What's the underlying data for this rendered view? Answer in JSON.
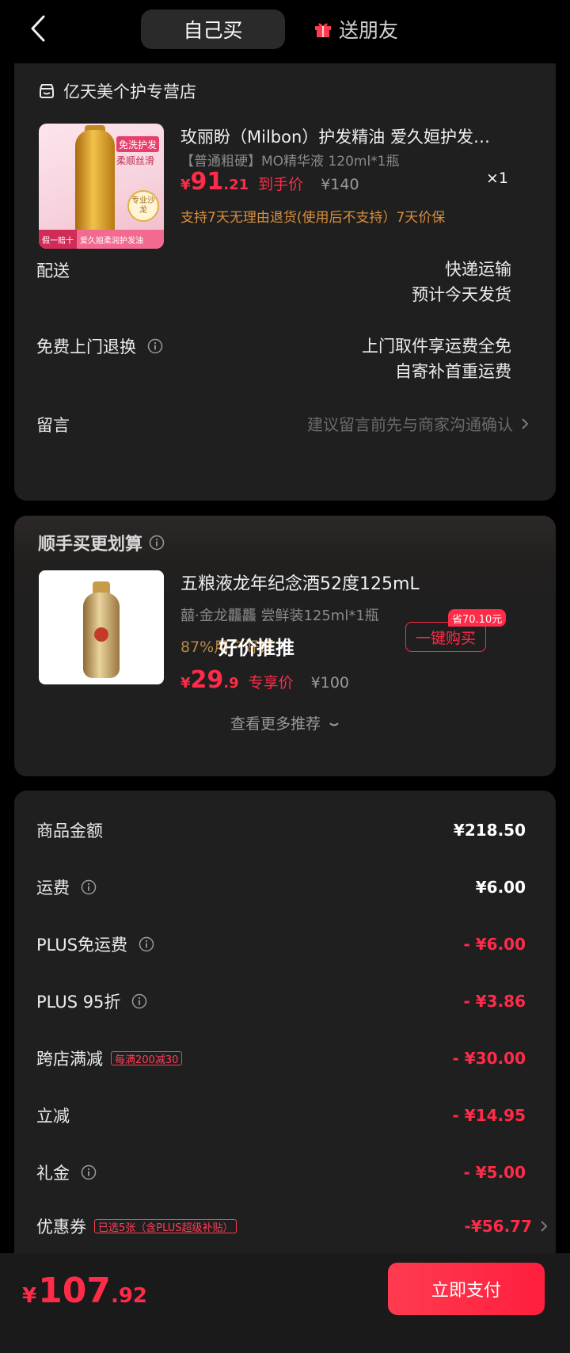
{
  "header": {
    "tab_self": "自己买",
    "tab_friend": "送朋友"
  },
  "store": {
    "name": "亿天美个护专营店",
    "product": {
      "image_texts": {
        "badge": "免洗护发",
        "headline": "柔顺丝滑",
        "seal": "专业沙龙",
        "footer_left": "假一赔十",
        "footer_right": "爱久姮柔润护发油"
      },
      "title": "玫丽盼（Milbon）护发精油 爱久姮护发精…",
      "sku": "【普通粗硬】MO精华液 120ml*1瓶",
      "price_yen": "¥",
      "price_int": "91",
      "price_dec": ".21",
      "price_label": "到手价",
      "original_price": "¥140",
      "quantity": "×1",
      "promise": "支持7天无理由退货(使用后不支持）7天价保"
    },
    "delivery": {
      "label": "配送",
      "line1": "快递运输",
      "line2": "预计今天发货"
    },
    "return": {
      "label": "免费上门退换",
      "line1": "上门取件享运费全免",
      "line2": "自寄补首重运费"
    },
    "message": {
      "label": "留言",
      "placeholder": "建议留言前先与商家沟通确认"
    }
  },
  "recommend": {
    "title": "顺手买更划算",
    "product": {
      "name": "五粮液龙年纪念酒52度125mL",
      "sku": "囍·金龙龘龘 尝鲜装125ml*1瓶",
      "rate": "87%用户好评",
      "overlay": "好价推推",
      "price_yen": "¥",
      "price_int": "29",
      "price_dec": ".9",
      "price_label": "专享价",
      "original_price": "¥100",
      "save_badge": "省70.10元",
      "buy_label": "一键购买"
    },
    "more_label": "查看更多推荐"
  },
  "summary": {
    "rows": [
      {
        "label": "商品金额",
        "value": "¥218.50"
      },
      {
        "label": "运费",
        "value": "¥6.00"
      },
      {
        "label": "PLUS免运费",
        "value": "- ¥6.00"
      },
      {
        "label": "PLUS 95折",
        "value": "- ¥3.86"
      },
      {
        "label": "跨店满减",
        "value": "- ¥30.00",
        "tag": "每满200减30"
      },
      {
        "label": "立减",
        "value": "- ¥14.95"
      },
      {
        "label": "礼金",
        "value": "- ¥5.00"
      },
      {
        "label": "优惠券",
        "value": "-¥56.77",
        "tag": "已选5张（含PLUS超级补贴）"
      }
    ]
  },
  "footer": {
    "total_yen": "¥",
    "total_int": "107",
    "total_dec": ".92",
    "pay_label": "立即支付"
  },
  "colors": {
    "accent_red": "#ff2b48",
    "promise_orange": "#d98f3c",
    "background": "#000000",
    "card": "#1f1f1f"
  }
}
